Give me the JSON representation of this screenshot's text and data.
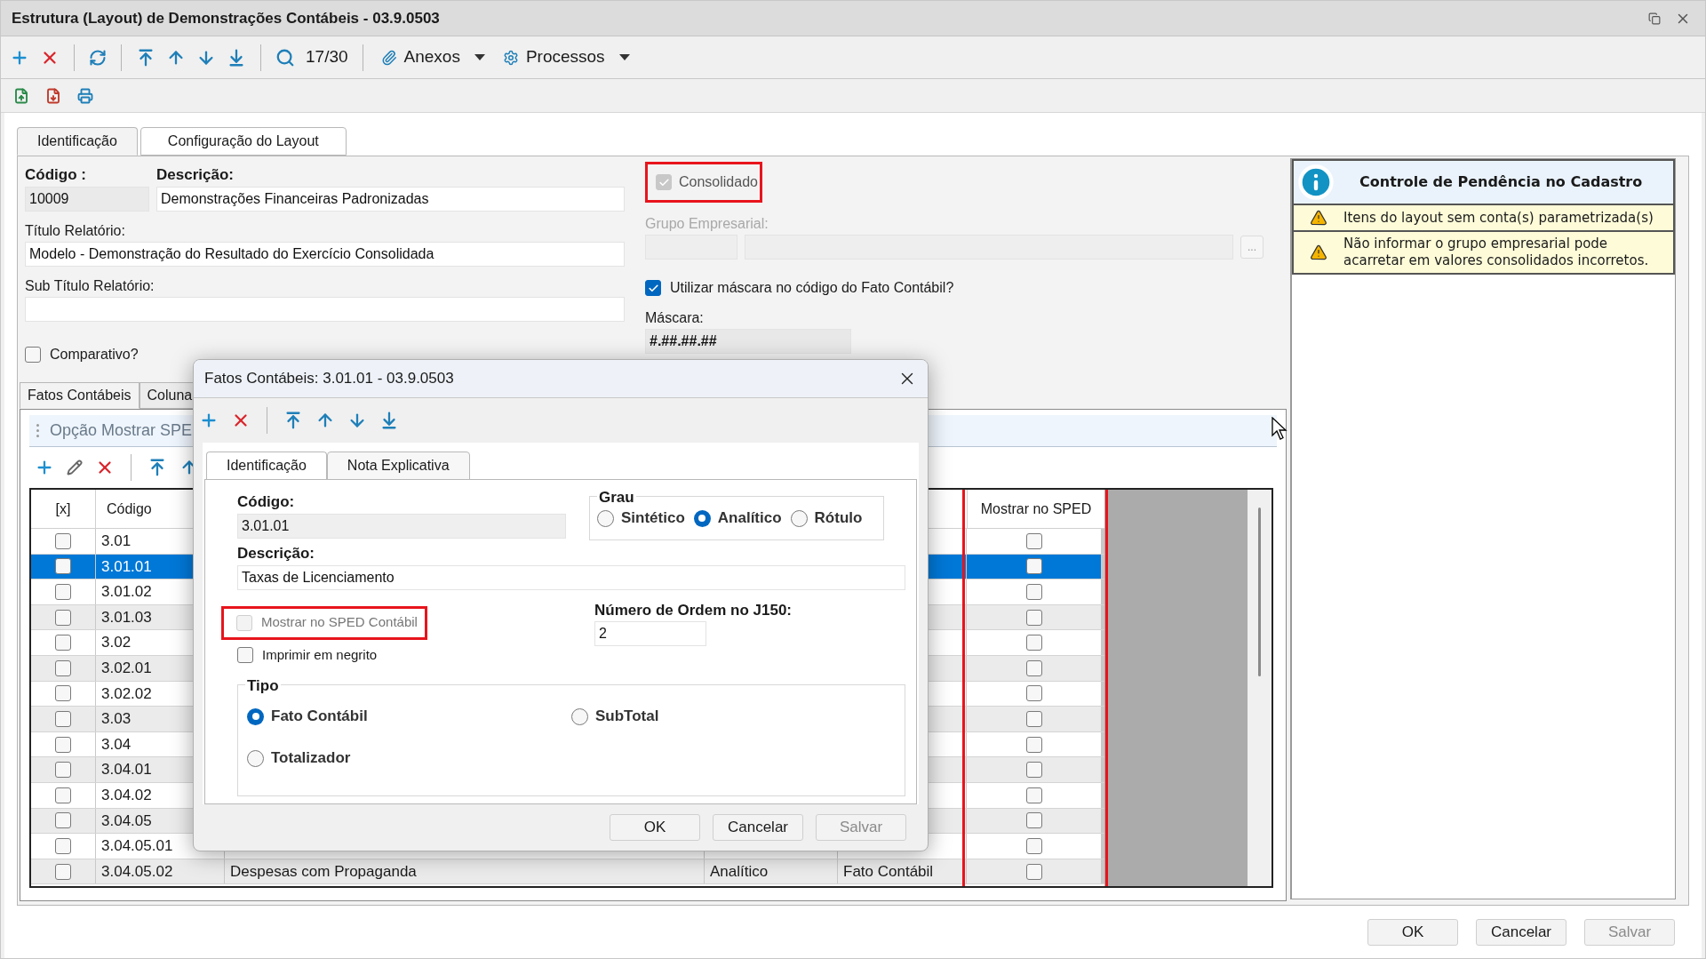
{
  "window": {
    "title": "Estrutura (Layout) de Demonstrações Contábeis - 03.9.0503"
  },
  "toolbar": {
    "record_position": "17/30",
    "menus": [
      "Anexos",
      "Processos"
    ]
  },
  "tabs": [
    {
      "label": "Identificação",
      "selected": true
    },
    {
      "label": "Configuração do Layout",
      "selected": false
    }
  ],
  "form": {
    "codigo": {
      "label": "Código :",
      "value": "10009"
    },
    "descricao": {
      "label": "Descrição:",
      "value": "Demonstrações Financeiras Padronizadas"
    },
    "consolidado": {
      "label": "Consolidado",
      "checked": true,
      "disabled": true,
      "highlighted": true
    },
    "titulo": {
      "label": "Título Relatório:",
      "value": "Modelo - Demonstração do Resultado do Exercício Consolidada"
    },
    "grupo_empresarial": {
      "label": "Grupo Empresarial:",
      "disabled": true,
      "button": "..."
    },
    "subtitulo": {
      "label": "Sub Título Relatório:"
    },
    "utilizar_mascara": {
      "label": "Utilizar máscara no código do Fato Contábil?",
      "checked": true
    },
    "mascara": {
      "label": "Máscara:",
      "value": "#.##.##.##"
    },
    "comparativo": {
      "label": "Comparativo?",
      "checked": false
    }
  },
  "pending_panel": {
    "title": "Controle de Pendência no Cadastro",
    "items": [
      "Itens do layout sem conta(s) parametrizada(s)",
      "Não informar o grupo empresarial pode acarretar em valores consolidados incorretos."
    ]
  },
  "sub_tabs": [
    {
      "label": "Fatos Contábeis",
      "selected": true
    },
    {
      "label": "Coluna",
      "selected": false
    }
  ],
  "option_bar": {
    "label": "Opção Mostrar SPE"
  },
  "grid": {
    "columns": [
      "[x]",
      "Código",
      "Mostrar no SPED"
    ],
    "sped_column_highlighted": true,
    "rows": [
      {
        "code": "3.01",
        "checked": false,
        "sped": false,
        "selected": false
      },
      {
        "code": "3.01.01",
        "checked": false,
        "sped": false,
        "selected": true
      },
      {
        "code": "3.01.02",
        "checked": false,
        "sped": false,
        "selected": false
      },
      {
        "code": "3.01.03",
        "checked": false,
        "sped": false,
        "selected": false
      },
      {
        "code": "3.02",
        "checked": false,
        "sped": false,
        "selected": false
      },
      {
        "code": "3.02.01",
        "checked": false,
        "sped": false,
        "selected": false
      },
      {
        "code": "3.02.02",
        "checked": false,
        "sped": false,
        "selected": false
      },
      {
        "code": "3.03",
        "checked": false,
        "sped": false,
        "selected": false
      },
      {
        "code": "3.04",
        "checked": false,
        "sped": false,
        "selected": false
      },
      {
        "code": "3.04.01",
        "checked": false,
        "sped": false,
        "selected": false
      },
      {
        "code": "3.04.02",
        "checked": false,
        "sped": false,
        "selected": false
      },
      {
        "code": "3.04.05",
        "checked": false,
        "sped": false,
        "selected": false
      },
      {
        "code": "3.04.05.01",
        "checked": false,
        "sped": false,
        "selected": false
      },
      {
        "code": "3.04.05.02",
        "checked": false,
        "sped": false,
        "selected": false,
        "column_3": "Despesas com Propaganda",
        "column_4": "Analítico",
        "column_5": "Fato Contábil"
      }
    ]
  },
  "dialog": {
    "title": "Fatos Contábeis: 3.01.01 - 03.9.0503",
    "tabs": [
      {
        "label": "Identificação",
        "selected": true
      },
      {
        "label": "Nota Explicativa",
        "selected": false
      }
    ],
    "codigo": {
      "label": "Código:",
      "value": "3.01.01"
    },
    "grau": {
      "label": "Grau",
      "options": [
        {
          "label": "Sintético",
          "selected": false
        },
        {
          "label": "Analítico",
          "selected": true
        },
        {
          "label": "Rótulo",
          "selected": false
        }
      ]
    },
    "descricao": {
      "label": "Descrição:",
      "value": "Taxas de Licenciamento"
    },
    "numero_ordem": {
      "label": "Número de Ordem no J150:",
      "value": "2"
    },
    "mostrar_sped": {
      "label": "Mostrar no SPED Contábil",
      "checked": false,
      "disabled": true,
      "highlighted": true
    },
    "imprimir_negrito": {
      "label": "Imprimir em negrito",
      "checked": false
    },
    "tipo": {
      "label": "Tipo",
      "options": [
        {
          "label": "Fato Contábil",
          "selected": true
        },
        {
          "label": "SubTotal",
          "selected": false
        },
        {
          "label": "Totalizador",
          "selected": false
        }
      ]
    },
    "buttons": [
      {
        "label": "OK",
        "disabled": false
      },
      {
        "label": "Cancelar",
        "disabled": false
      },
      {
        "label": "Salvar",
        "disabled": true
      }
    ]
  },
  "buttons": [
    {
      "label": "OK",
      "disabled": false
    },
    {
      "label": "Cancelar",
      "disabled": false
    },
    {
      "label": "Salvar",
      "disabled": true
    }
  ]
}
